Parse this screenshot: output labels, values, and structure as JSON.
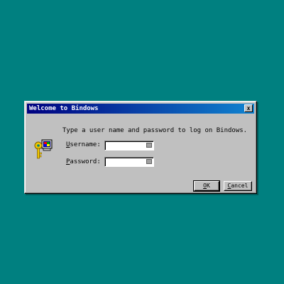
{
  "dialog": {
    "title": "Welcome to Bindows",
    "close_label": "x",
    "prompt": "Type a user name and password to log on Bindows.",
    "username": {
      "mnemonic": "U",
      "rest": "sername:",
      "value": ""
    },
    "password": {
      "mnemonic": "P",
      "rest": "assword:",
      "value": ""
    },
    "ok": {
      "mnemonic": "O",
      "rest": "K"
    },
    "cancel": {
      "mnemonic": "C",
      "rest": "ancel"
    }
  },
  "colors": {
    "desktop": "#008080",
    "title_start": "#000080",
    "title_end": "#1084d0",
    "face": "#c0c0c0"
  },
  "icons": {
    "login": "key-computer-icon",
    "keyboard": "keyboard-icon"
  }
}
